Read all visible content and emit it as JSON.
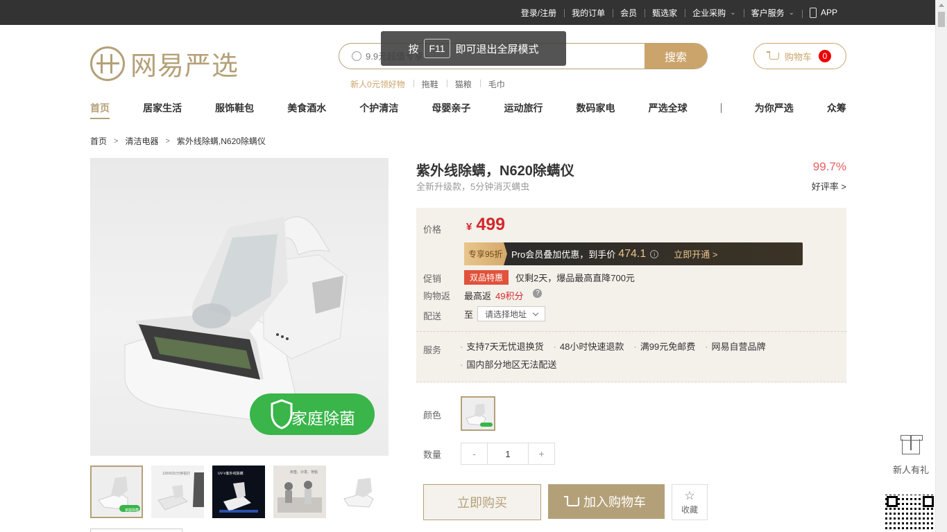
{
  "topbar": {
    "links": [
      {
        "label": "登录/注册",
        "chevron": false
      },
      {
        "label": "我的订单",
        "chevron": false
      },
      {
        "label": "会员",
        "chevron": false
      },
      {
        "label": "甄选家",
        "chevron": false
      },
      {
        "label": "企业采购",
        "chevron": true
      },
      {
        "label": "客户服务",
        "chevron": true
      }
    ],
    "app_label": "APP"
  },
  "fullscreen_notice": {
    "prefix": "按",
    "key": "F11",
    "suffix": "即可退出全屏模式"
  },
  "logo": {
    "text": "网易严选"
  },
  "search": {
    "placeholder": "9.9元超值专享",
    "button": "搜索"
  },
  "hotwords": [
    "新人0元领好物",
    "拖鞋",
    "猫粮",
    "毛巾"
  ],
  "cart": {
    "label": "购物车",
    "count": "0"
  },
  "nav": [
    "首页",
    "居家生活",
    "服饰鞋包",
    "美食酒水",
    "个护清洁",
    "母婴亲子",
    "运动旅行",
    "数码家电",
    "严选全球",
    "为你严选",
    "众筹"
  ],
  "breadcrumb": [
    "首页",
    "清洁电器",
    "紫外线除螨,N620除螨仪"
  ],
  "product": {
    "title": "紫外线除螨，N620除螨仪",
    "subtitle": "全新升级款，5分钟消灭螨虫",
    "rating": "99.7%",
    "rating_label": "好评率 >",
    "image_badge": "家庭除菌"
  },
  "price": {
    "label": "价格",
    "currency": "¥",
    "value": "499",
    "pro_tag": "专享95折",
    "pro_text": "Pro会员叠加优惠，到手价",
    "pro_price": "474.1",
    "pro_open": "立即开通 >"
  },
  "promo": {
    "label": "促销",
    "tag": "双品特惠",
    "text": "仅剩2天，爆品最高直降700元"
  },
  "rebate": {
    "label": "购物返",
    "text": "最高返",
    "points": "49积分"
  },
  "shipping": {
    "label": "配送",
    "prefix": "至",
    "select": "请选择地址"
  },
  "services": {
    "label": "服务",
    "items": [
      "支持7天无忧退换货",
      "48小时快速退款",
      "满99元免邮费",
      "网易自营品牌",
      "国内部分地区无法配送"
    ]
  },
  "options": {
    "color_label": "颜色",
    "qty_label": "数量",
    "qty_value": "1",
    "minus": "-",
    "plus": "+"
  },
  "actions": {
    "buy": "立即购买",
    "add_cart": "加入购物车",
    "favorite": "收藏"
  },
  "sidebar": {
    "gift_label": "新人有礼"
  },
  "thumbnails": [
    {
      "caption": "家庭除菌"
    },
    {
      "caption": "12000次/分钟拍打"
    },
    {
      "caption": "UV-V紫外线除螨"
    },
    {
      "caption": "床垫、沙发、地毯"
    },
    {
      "caption": ""
    }
  ],
  "colors": {
    "accent": "#b4a078",
    "price_red": "#d4282d",
    "topbar": "#333333"
  }
}
